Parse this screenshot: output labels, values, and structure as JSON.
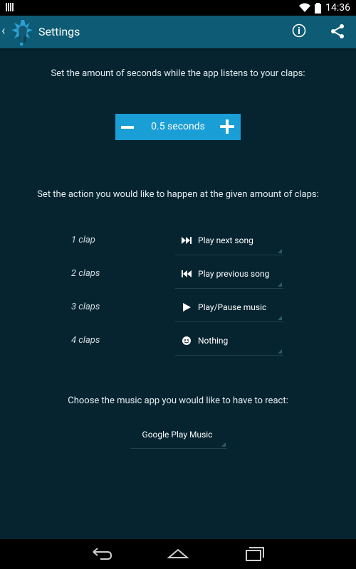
{
  "status": {
    "time": "14:36"
  },
  "action_bar": {
    "title": "Settings"
  },
  "content": {
    "seconds_prompt": "Set the amount of seconds while the app listens to your claps:",
    "seconds_value": "0.5 seconds",
    "action_prompt": "Set the action you would like to happen at the given amount of claps:",
    "clap_rows": [
      {
        "label": "1 clap",
        "action": "Play next song",
        "icon": "skip-next-icon"
      },
      {
        "label": "2 claps",
        "action": "Play previous song",
        "icon": "skip-previous-icon"
      },
      {
        "label": "3 claps",
        "action": "Play/Pause music",
        "icon": "play-icon"
      },
      {
        "label": "4 claps",
        "action": "Nothing",
        "icon": "smiley-icon"
      }
    ],
    "music_prompt": "Choose the music app you would like to have to react:",
    "music_app": "Google Play Music"
  },
  "colors": {
    "background": "#062430",
    "action_bar": "#0d5b74",
    "accent": "#1a9ed6"
  },
  "icons": [
    "back-chevron-icon",
    "app-logo-icon",
    "info-icon",
    "share-icon",
    "back-icon",
    "home-icon",
    "recents-icon",
    "wifi-icon",
    "battery-icon"
  ]
}
